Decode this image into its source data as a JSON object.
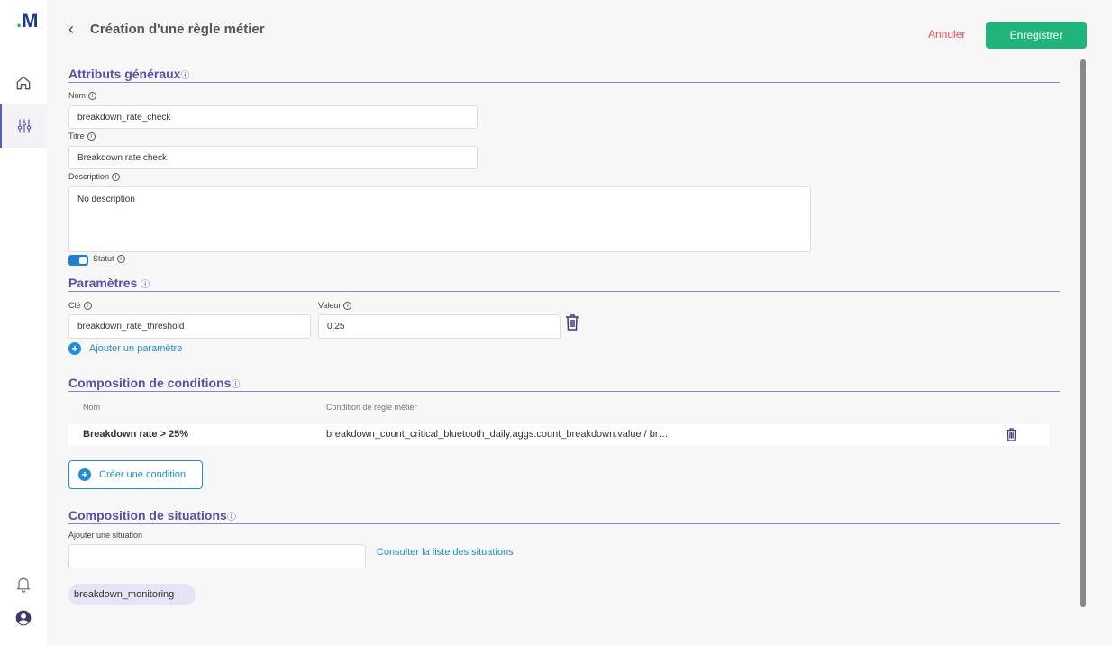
{
  "brand": {
    "logo": "M"
  },
  "header": {
    "title": "Création d'une règle métier",
    "cancel_label": "Annuler",
    "save_label": "Enregistrer"
  },
  "general": {
    "title": "Attributs généraux",
    "name_label": "Nom",
    "name_value": "breakdown_rate_check",
    "title_label": "Titre",
    "title_value": "Breakdown rate check",
    "description_label": "Description",
    "description_value": "No description",
    "status_label": "Statut",
    "status_on": true
  },
  "params": {
    "title": "Paramètres",
    "key_label": "Clé",
    "value_label": "Valeur",
    "items": [
      {
        "key": "breakdown_rate_threshold",
        "value": "0.25"
      }
    ],
    "add_label": "Ajouter un paramètre"
  },
  "conditions": {
    "title": "Composition de conditions",
    "col_name": "Nom",
    "col_condition": "Condition de règle métier",
    "rows": [
      {
        "name": "Breakdown rate > 25%",
        "condition": "breakdown_count_critical_bluetooth_daily.aggs.count_breakdown.value / br…"
      }
    ],
    "create_label": "Créer une condition"
  },
  "situations": {
    "title": "Composition de situations",
    "add_label": "Ajouter une situation",
    "input_value": "",
    "consult_label": "Consulter la liste des situations",
    "chips": [
      "breakdown_monitoring"
    ]
  },
  "colors": {
    "accent": "#5a4ea8",
    "primary": "#20b37a",
    "link": "#1f8fc4",
    "danger": "#e84b5a"
  },
  "icons": [
    "home-icon",
    "sliders-icon",
    "bell-icon",
    "user-icon",
    "trash-icon",
    "info-icon",
    "chevron-left-icon",
    "plus-circle-icon"
  ]
}
